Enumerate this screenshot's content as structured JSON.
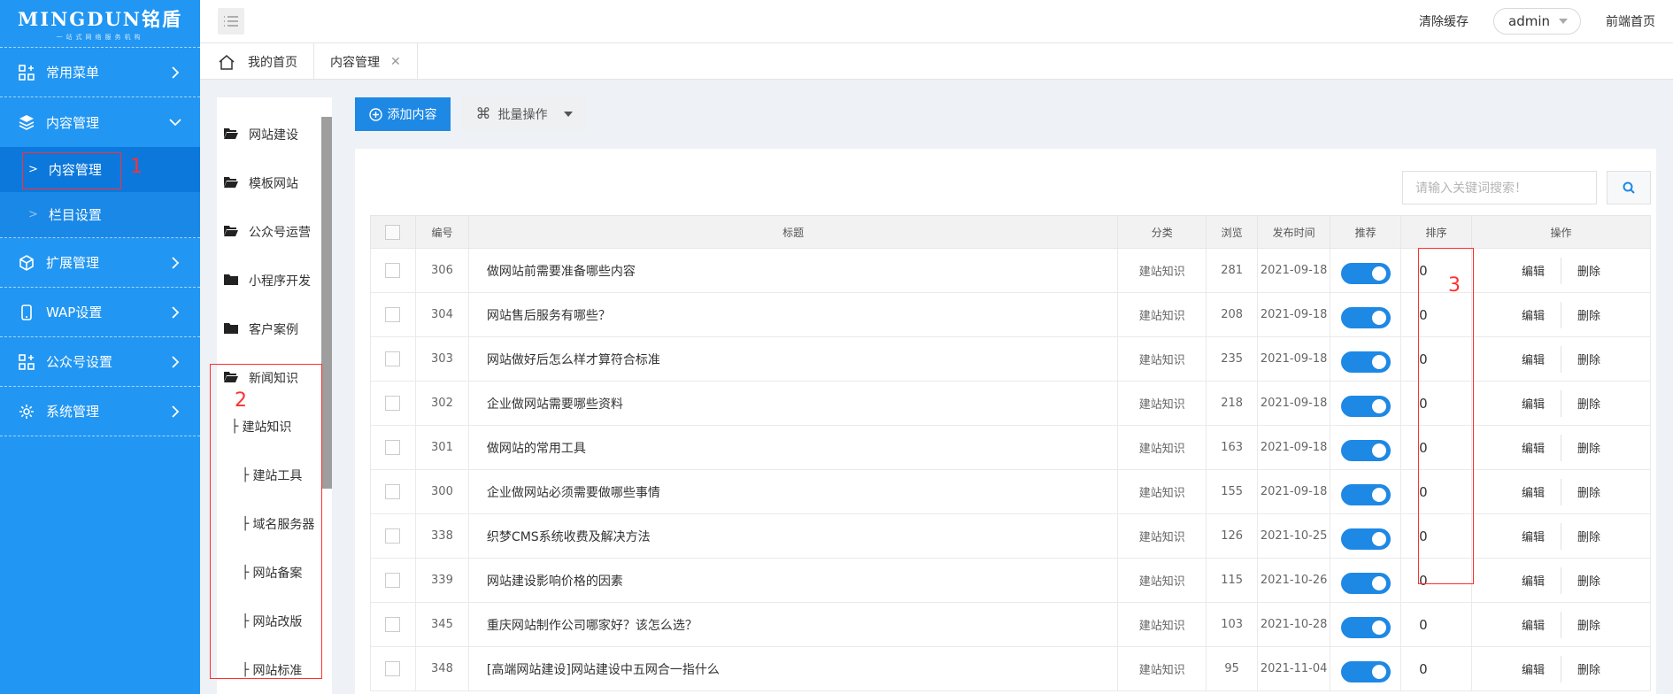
{
  "logo": {
    "brand": "MINGDUN铭盾",
    "tagline": "一站式网络服务机构"
  },
  "sidebar": {
    "items": [
      {
        "label": "常用菜单",
        "icon": "grid-plus-icon"
      },
      {
        "label": "内容管理",
        "icon": "layers-icon",
        "expanded": true,
        "children": [
          {
            "label": "内容管理",
            "active": true
          },
          {
            "label": "栏目设置"
          }
        ]
      },
      {
        "label": "扩展管理",
        "icon": "cube-icon"
      },
      {
        "label": "WAP设置",
        "icon": "mobile-icon"
      },
      {
        "label": "公众号设置",
        "icon": "grid-plus-icon"
      },
      {
        "label": "系统管理",
        "icon": "gear-icon"
      }
    ]
  },
  "annotations": [
    "1",
    "2",
    "3"
  ],
  "topbar": {
    "clear_cache": "清除缓存",
    "user": "admin",
    "frontend": "前端首页"
  },
  "tabs": [
    {
      "label": "我的首页"
    },
    {
      "label": "内容管理"
    }
  ],
  "tree": {
    "nodes": [
      "网站建设",
      "模板网站",
      "公众号运营",
      "小程序开发",
      "客户案例",
      "新闻知识"
    ],
    "children": [
      "建站知识",
      "建站工具",
      "域名服务器",
      "网站备案",
      "网站改版",
      "网站标准"
    ]
  },
  "toolbar": {
    "add": "添加内容",
    "batch": "批量操作"
  },
  "search": {
    "placeholder": "请输入关键词搜索！"
  },
  "table": {
    "headers": [
      "编号",
      "标题",
      "分类",
      "浏览",
      "发布时间",
      "推荐",
      "排序",
      "操作"
    ],
    "edit": "编辑",
    "delete": "删除",
    "rows": [
      {
        "id": "306",
        "title": "做网站前需要准备哪些内容",
        "cat": "建站知识",
        "views": "281",
        "date": "2021-09-18",
        "sort": "0"
      },
      {
        "id": "304",
        "title": "网站售后服务有哪些？",
        "cat": "建站知识",
        "views": "208",
        "date": "2021-09-18",
        "sort": "0"
      },
      {
        "id": "303",
        "title": "网站做好后怎么样才算符合标准",
        "cat": "建站知识",
        "views": "235",
        "date": "2021-09-18",
        "sort": "0"
      },
      {
        "id": "302",
        "title": "企业做网站需要哪些资料",
        "cat": "建站知识",
        "views": "218",
        "date": "2021-09-18",
        "sort": "0"
      },
      {
        "id": "301",
        "title": "做网站的常用工具",
        "cat": "建站知识",
        "views": "163",
        "date": "2021-09-18",
        "sort": "0"
      },
      {
        "id": "300",
        "title": "企业做网站必须需要做哪些事情",
        "cat": "建站知识",
        "views": "155",
        "date": "2021-09-18",
        "sort": "0"
      },
      {
        "id": "338",
        "title": "织梦CMS系统收费及解决方法",
        "cat": "建站知识",
        "views": "126",
        "date": "2021-10-25",
        "sort": "0"
      },
      {
        "id": "339",
        "title": "网站建设影响价格的因素",
        "cat": "建站知识",
        "views": "115",
        "date": "2021-10-26",
        "sort": "0"
      },
      {
        "id": "345",
        "title": "重庆网站制作公司哪家好？该怎么选？",
        "cat": "建站知识",
        "views": "103",
        "date": "2021-10-28",
        "sort": "0"
      },
      {
        "id": "348",
        "title": "[高端网站建设]网站建设中五网合一指什么",
        "cat": "建站知识",
        "views": "95",
        "date": "2021-11-04",
        "sort": "0"
      }
    ]
  },
  "colors": {
    "primary": "#2196f3",
    "annotation": "#ff3030"
  }
}
